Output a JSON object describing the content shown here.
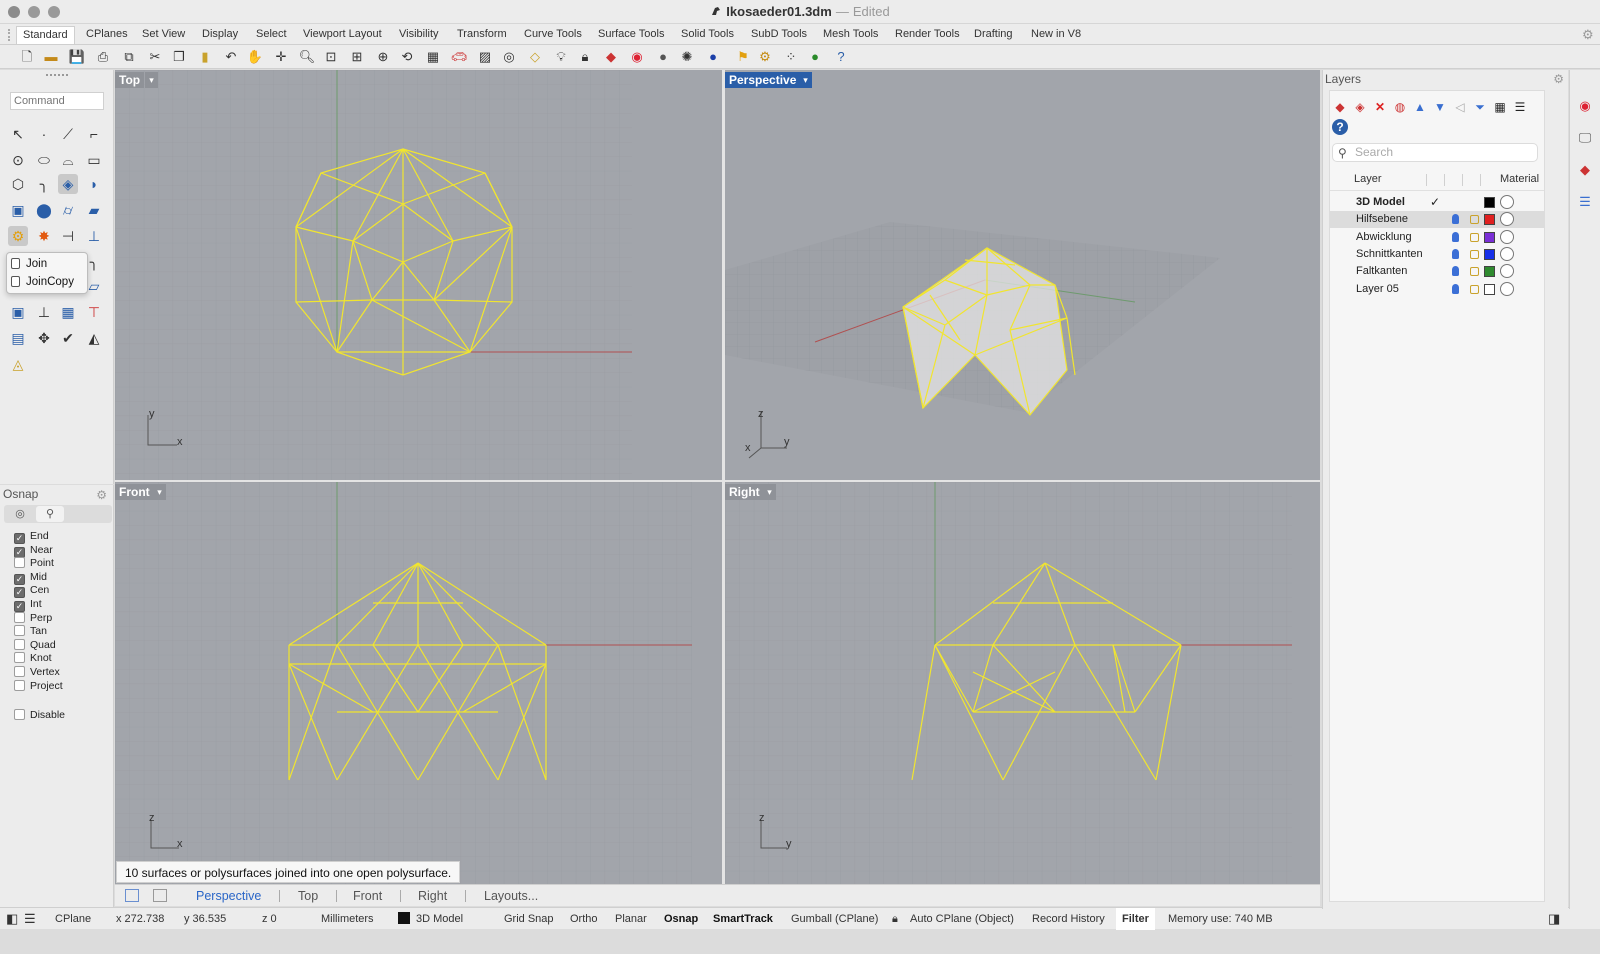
{
  "window": {
    "file_name": "Ikosaeder01.3dm",
    "separator": "—",
    "status": "Edited"
  },
  "tabs": [
    "Standard",
    "CPlanes",
    "Set View",
    "Display",
    "Select",
    "Viewport Layout",
    "Visibility",
    "Transform",
    "Curve Tools",
    "Surface Tools",
    "Solid Tools",
    "SubD Tools",
    "Mesh Tools",
    "Render Tools",
    "Drafting",
    "New in V8"
  ],
  "active_tab": "Standard",
  "command": {
    "placeholder": "Command"
  },
  "flyout": {
    "items": [
      "Join",
      "JoinCopy"
    ]
  },
  "osnap": {
    "title": "Osnap",
    "items": [
      {
        "label": "End",
        "checked": true
      },
      {
        "label": "Near",
        "checked": true
      },
      {
        "label": "Point",
        "checked": false
      },
      {
        "label": "Mid",
        "checked": true
      },
      {
        "label": "Cen",
        "checked": true
      },
      {
        "label": "Int",
        "checked": true
      },
      {
        "label": "Perp",
        "checked": false
      },
      {
        "label": "Tan",
        "checked": false
      },
      {
        "label": "Quad",
        "checked": false
      },
      {
        "label": "Knot",
        "checked": false
      },
      {
        "label": "Vertex",
        "checked": false
      },
      {
        "label": "Project",
        "checked": false
      }
    ],
    "disable": {
      "label": "Disable",
      "checked": false
    }
  },
  "viewports": {
    "top": {
      "label": "Top",
      "axes": [
        "y",
        "x"
      ]
    },
    "perspective": {
      "label": "Perspective",
      "axes": [
        "z",
        "y",
        "x"
      ]
    },
    "front": {
      "label": "Front",
      "axes": [
        "z",
        "x"
      ]
    },
    "right": {
      "label": "Right",
      "axes": [
        "z",
        "y"
      ]
    }
  },
  "message": "10 surfaces or polysurfaces joined into one open polysurface.",
  "viewport_tabs": [
    "Perspective",
    "Top",
    "Front",
    "Right",
    "Layouts..."
  ],
  "active_viewport_tab": "Perspective",
  "statusbar": {
    "cplane": "CPlane",
    "x": "x 272.738",
    "y": "y 36.535",
    "z": "z 0",
    "units": "Millimeters",
    "layer": "3D Model",
    "grid_snap": "Grid Snap",
    "ortho": "Ortho",
    "planar": "Planar",
    "osnap": "Osnap",
    "smarttrack": "SmartTrack",
    "gumball": "Gumball (CPlane)",
    "autocplane": "Auto CPlane (Object)",
    "record_history": "Record History",
    "filter": "Filter",
    "memory": "Memory use: 740 MB"
  },
  "layers": {
    "title": "Layers",
    "search_placeholder": "Search",
    "col_layer": "Layer",
    "col_material": "Material",
    "rows": [
      {
        "name": "3D Model",
        "current": true,
        "color": "#000000",
        "bold": true,
        "selected": false
      },
      {
        "name": "Hilfsebene",
        "current": false,
        "color": "#e02020",
        "bold": false,
        "selected": true
      },
      {
        "name": "Abwicklung",
        "current": false,
        "color": "#7a2fd6",
        "bold": false,
        "selected": false
      },
      {
        "name": "Schnittkanten",
        "current": false,
        "color": "#1730e8",
        "bold": false,
        "selected": false
      },
      {
        "name": "Faltkanten",
        "current": false,
        "color": "#2f8a2f",
        "bold": false,
        "selected": false
      },
      {
        "name": "Layer 05",
        "current": false,
        "color": "#ffffff",
        "bold": false,
        "selected": false
      }
    ]
  },
  "colors": {
    "accent": "#2a5ea8",
    "wireframe": "#f1e52f",
    "viewport_bg": "#a2a5ab"
  }
}
